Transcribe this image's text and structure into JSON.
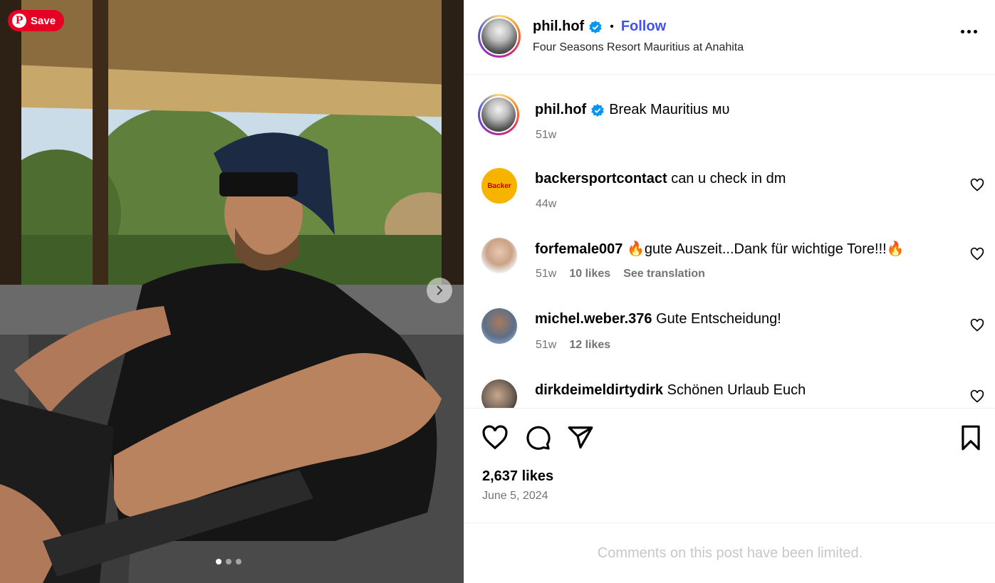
{
  "media": {
    "save_label": "Save",
    "pinterest_letter": "P",
    "carousel": {
      "count": 3,
      "active": 0
    }
  },
  "post_header": {
    "username": "phil.hof",
    "separator": "•",
    "follow_label": "Follow",
    "location": "Four Seasons Resort Mauritius at Anahita"
  },
  "caption": {
    "username": "phil.hof",
    "text": "Break Mauritius ᴍᴜ",
    "time": "51w"
  },
  "comments": [
    {
      "username": "backersportcontact",
      "text": "can u check in dm",
      "time": "44w",
      "likes": "",
      "translation": "",
      "avatar_text": "Backer"
    },
    {
      "username": "forfemale007",
      "text": "🔥gute Auszeit...Dank für wichtige Tore!!!🔥",
      "time": "51w",
      "likes": "10 likes",
      "translation": "See translation"
    },
    {
      "username": "michel.weber.376",
      "text": "Gute Entscheidung!",
      "time": "51w",
      "likes": "12 likes",
      "translation": ""
    },
    {
      "username": "dirkdeimeldirtydirk",
      "text": "Schönen Urlaub Euch",
      "time": "",
      "likes": "",
      "translation": ""
    }
  ],
  "footer": {
    "likes": "2,637 likes",
    "date": "June 5, 2024",
    "limited_notice": "Comments on this post have been limited."
  },
  "colors": {
    "follow": "#4150f7",
    "verified": "#0095f6",
    "pinterest": "#e60023"
  }
}
